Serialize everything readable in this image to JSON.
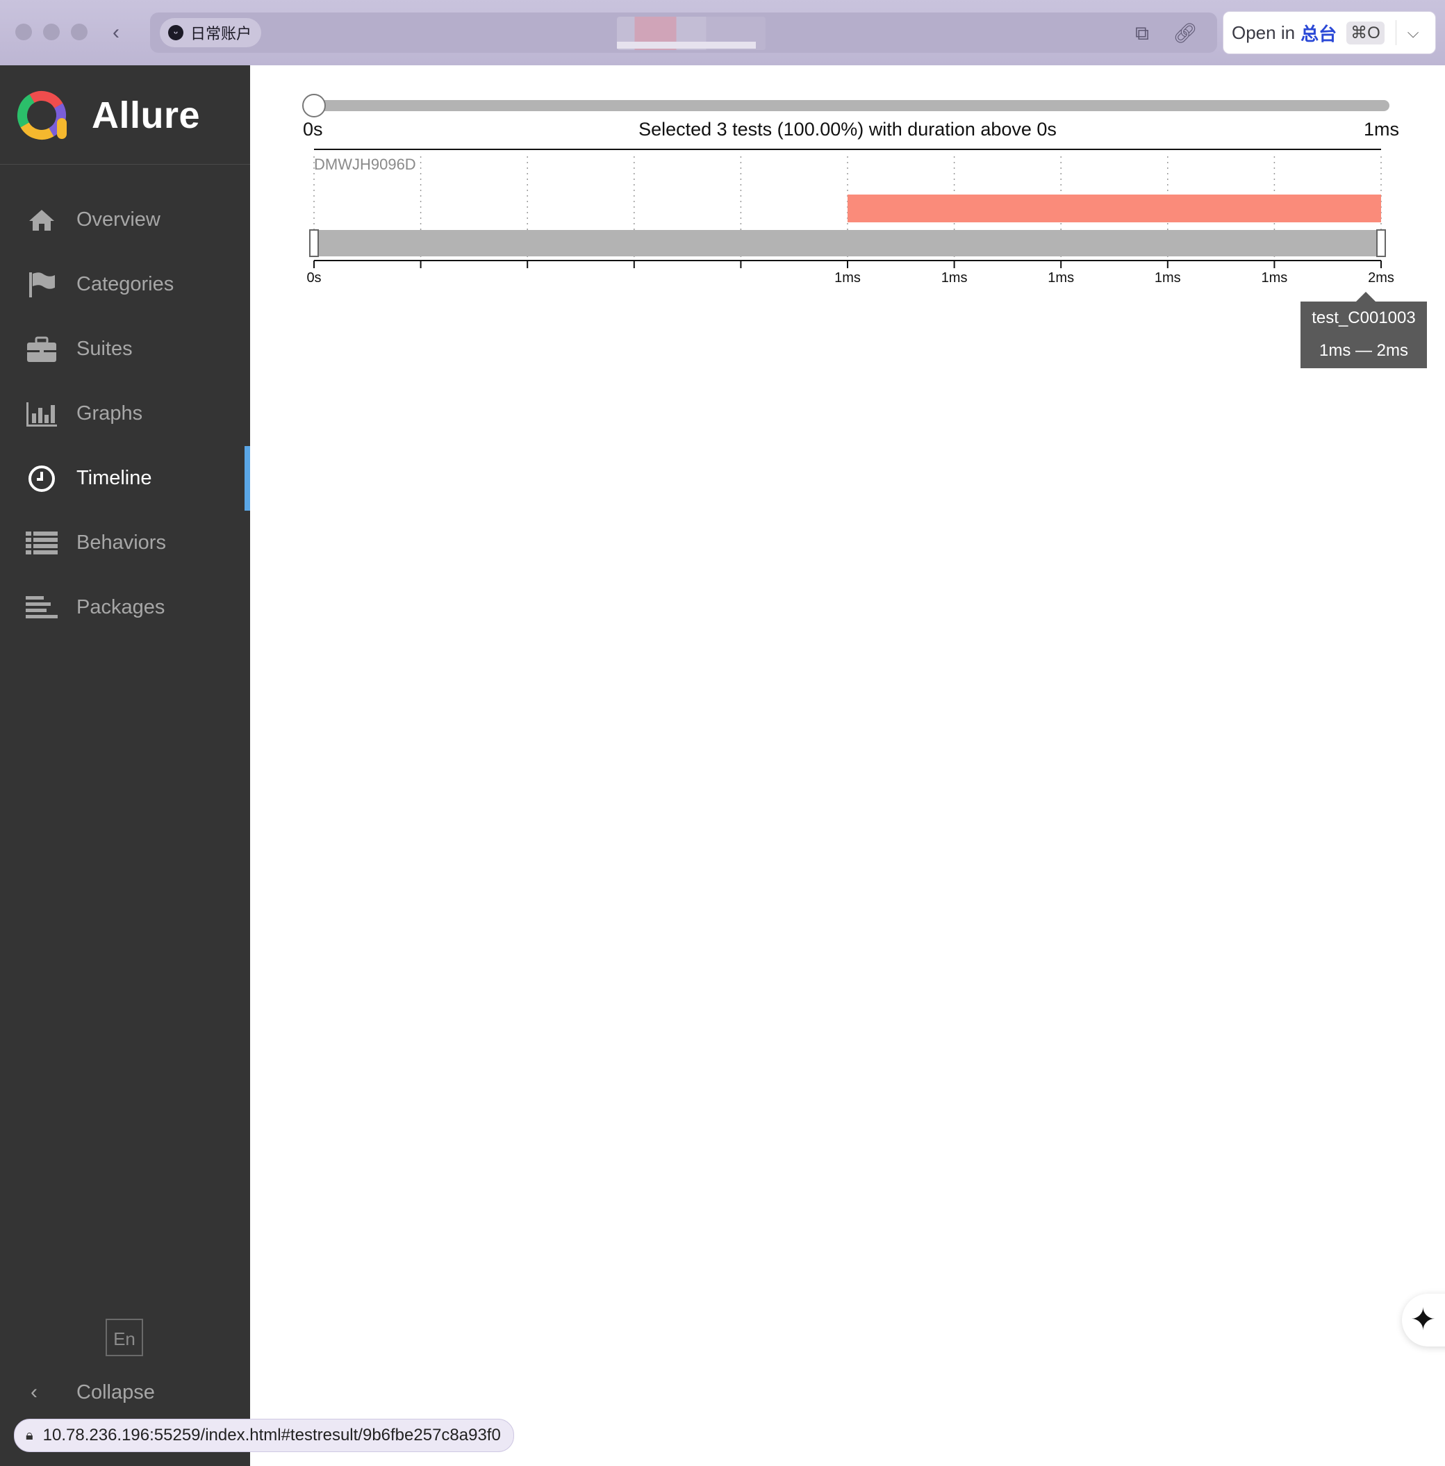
{
  "browser": {
    "account_label": "日常账户",
    "open_in": {
      "label": "Open in",
      "app": "总台",
      "shortcut": "⌘O"
    }
  },
  "sidebar": {
    "brand": "Allure",
    "items": [
      {
        "label": "Overview",
        "icon": "home-icon",
        "active": false
      },
      {
        "label": "Categories",
        "icon": "flag-icon",
        "active": false
      },
      {
        "label": "Suites",
        "icon": "briefcase-icon",
        "active": false
      },
      {
        "label": "Graphs",
        "icon": "bar-chart-icon",
        "active": false
      },
      {
        "label": "Timeline",
        "icon": "clock-icon",
        "active": true
      },
      {
        "label": "Behaviors",
        "icon": "list-icon",
        "active": false
      },
      {
        "label": "Packages",
        "icon": "align-left-icon",
        "active": false
      }
    ],
    "language": "En",
    "collapse_label": "Collapse"
  },
  "timeline": {
    "slider": {
      "min_label": "0s",
      "max_label": "1ms",
      "summary": "Selected 3 tests (100.00%) with duration above 0s"
    },
    "host": "DMWJH9096D",
    "axis_ticks": [
      "0s",
      "",
      "",
      "",
      "",
      "1ms",
      "1ms",
      "1ms",
      "1ms",
      "1ms",
      "2ms"
    ],
    "tooltip": {
      "test": "test_C001003",
      "range": "1ms — 2ms"
    }
  },
  "chart_data": {
    "type": "timeline",
    "row": "DMWJH9096D",
    "bars": [
      {
        "test": "test_C001003",
        "start_ms": 1,
        "end_ms": 2,
        "color": "#fa8b7a"
      }
    ],
    "x_ticks": [
      "0s",
      "",
      "",
      "",
      "",
      "1ms",
      "1ms",
      "1ms",
      "1ms",
      "1ms",
      "2ms"
    ]
  },
  "status_url": "10.78.236.196:55259/index.html#testresult/9b6fbe257c8a93f0",
  "colors": {
    "sidebar": "#343434",
    "accent": "#5aa6e6",
    "bar": "#fa8b7a"
  }
}
